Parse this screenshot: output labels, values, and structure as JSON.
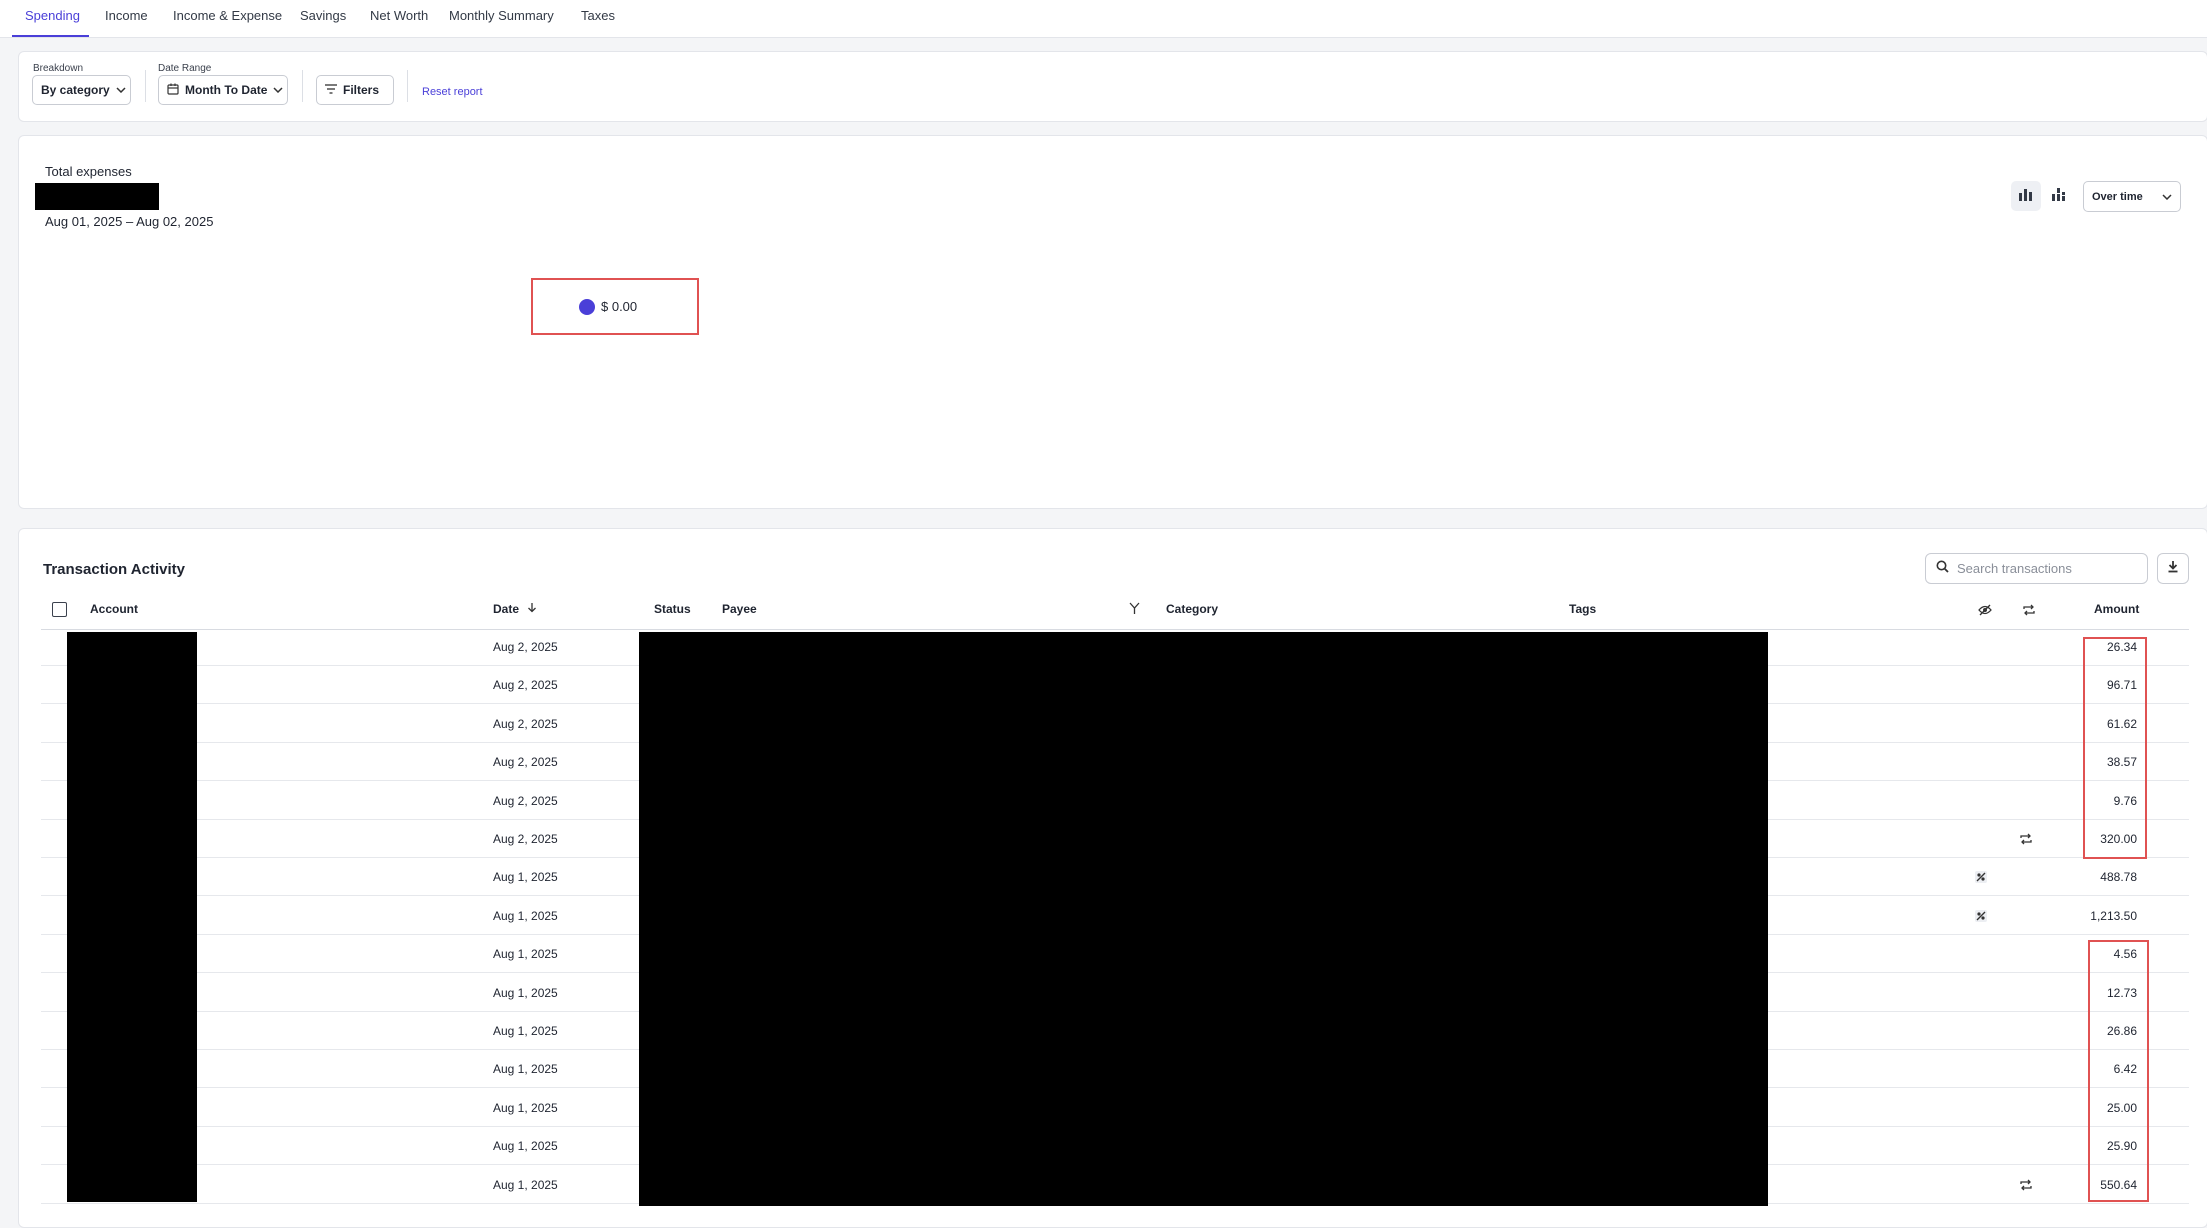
{
  "tabs": [
    {
      "label": "Spending"
    },
    {
      "label": "Income"
    },
    {
      "label": "Income & Expense"
    },
    {
      "label": "Savings"
    },
    {
      "label": "Net Worth"
    },
    {
      "label": "Monthly Summary"
    },
    {
      "label": "Taxes"
    }
  ],
  "active_tab": "Spending",
  "controls": {
    "breakdown_label": "Breakdown",
    "breakdown_value": "By category",
    "date_range_label": "Date Range",
    "date_range_value": "Month To Date",
    "filters_label": "Filters",
    "reset_label": "Reset report"
  },
  "summary": {
    "total_label": "Total expenses",
    "date_range_text": "Aug 01, 2025 – Aug 02, 2025",
    "view_mode": "Over time",
    "legend_value": "$ 0.00",
    "legend_color": "#4a3fd8"
  },
  "transactions": {
    "title": "Transaction Activity",
    "search_placeholder": "Search transactions",
    "columns": {
      "account": "Account",
      "date": "Date",
      "status": "Status",
      "payee": "Payee",
      "category": "Category",
      "tags": "Tags",
      "amount": "Amount"
    },
    "rows": [
      {
        "date": "Aug 2, 2025",
        "amount": "26.34",
        "icon": ""
      },
      {
        "date": "Aug 2, 2025",
        "amount": "96.71",
        "icon": ""
      },
      {
        "date": "Aug 2, 2025",
        "amount": "61.62",
        "icon": ""
      },
      {
        "date": "Aug 2, 2025",
        "amount": "38.57",
        "icon": ""
      },
      {
        "date": "Aug 2, 2025",
        "amount": "9.76",
        "icon": ""
      },
      {
        "date": "Aug 2, 2025",
        "amount": "320.00",
        "icon": "recurring-icon"
      },
      {
        "date": "Aug 1, 2025",
        "amount": "488.78",
        "icon": "split-icon"
      },
      {
        "date": "Aug 1, 2025",
        "amount": "1,213.50",
        "icon": "split-icon"
      },
      {
        "date": "Aug 1, 2025",
        "amount": "4.56",
        "icon": ""
      },
      {
        "date": "Aug 1, 2025",
        "amount": "12.73",
        "icon": ""
      },
      {
        "date": "Aug 1, 2025",
        "amount": "26.86",
        "icon": ""
      },
      {
        "date": "Aug 1, 2025",
        "amount": "6.42",
        "icon": ""
      },
      {
        "date": "Aug 1, 2025",
        "amount": "25.00",
        "icon": ""
      },
      {
        "date": "Aug 1, 2025",
        "amount": "25.90",
        "icon": ""
      },
      {
        "date": "Aug 1, 2025",
        "amount": "550.64",
        "icon": "recurring-icon"
      }
    ]
  },
  "colors": {
    "accent": "#4a3fd8",
    "highlight": "#e05252"
  }
}
